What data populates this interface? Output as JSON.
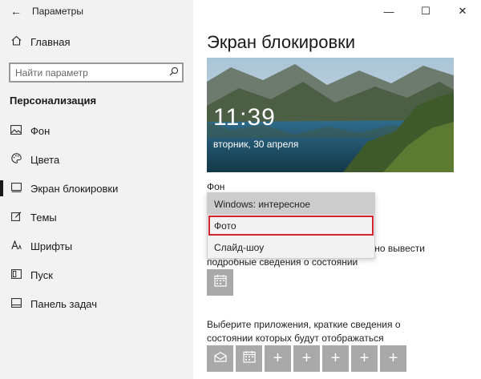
{
  "window": {
    "title": "Параметры",
    "back_glyph": "←",
    "minimize_glyph": "—",
    "maximize_glyph": "☐",
    "close_glyph": "✕"
  },
  "sidebar": {
    "home_label": "Главная",
    "search_placeholder": "Найти параметр",
    "section_title": "Персонализация",
    "items": [
      {
        "label": "Фон",
        "icon": "image-icon"
      },
      {
        "label": "Цвета",
        "icon": "palette-icon"
      },
      {
        "label": "Экран блокировки",
        "icon": "lock-screen-icon",
        "active": true
      },
      {
        "label": "Темы",
        "icon": "brush-icon"
      },
      {
        "label": "Шрифты",
        "icon": "font-icon"
      },
      {
        "label": "Пуск",
        "icon": "start-icon"
      },
      {
        "label": "Панель задач",
        "icon": "taskbar-icon"
      }
    ]
  },
  "main": {
    "title": "Экран блокировки",
    "preview": {
      "time": "11:39",
      "date": "вторник, 30 апреля"
    },
    "background_label": "Фон",
    "dropdown": {
      "options": [
        "Windows: интересное",
        "Фото",
        "Слайд-шоу"
      ],
      "selected_index": 0,
      "highlighted_index": 1
    },
    "detailed_status_text_partial_right": "жно вывести",
    "detailed_status_text_line2": "подробные сведения о состоянии",
    "choose_apps_text": "Выберите приложения, краткие сведения о состоянии которых будут отображаться"
  },
  "colors": {
    "sidebar_bg": "#f2f2f2",
    "tile_bg": "#a9a9a9",
    "highlight_border": "#d4242c",
    "selected_option_bg": "#cccccc"
  }
}
